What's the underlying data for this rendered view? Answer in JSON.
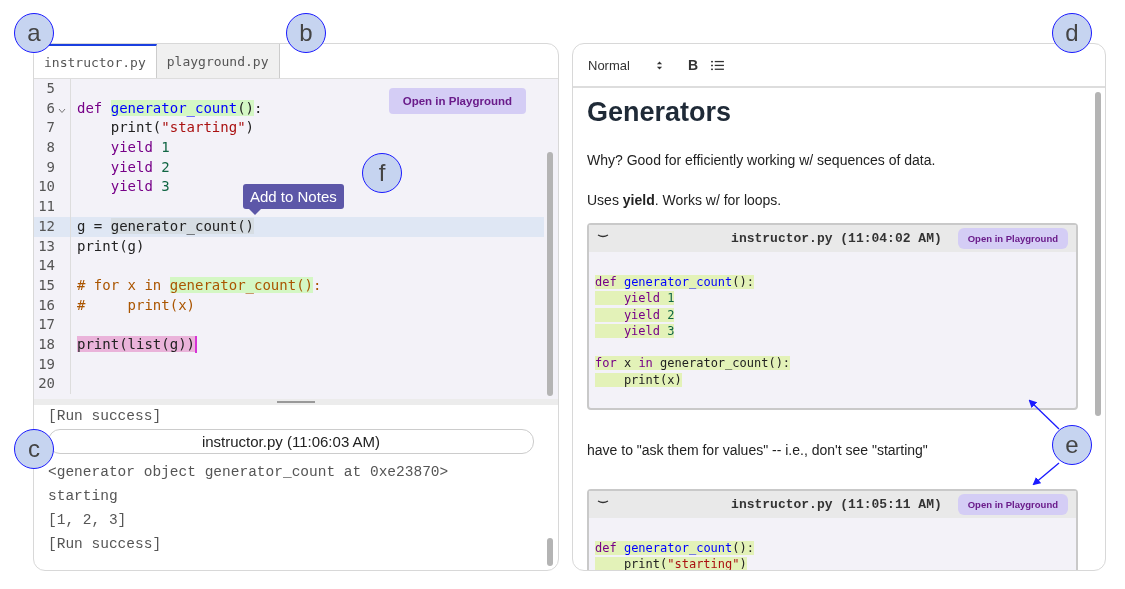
{
  "editor": {
    "tabs": [
      {
        "label": "instructor.py",
        "selected": true
      },
      {
        "label": "playground.py",
        "selected": false
      }
    ],
    "open_button": "Open in Playground",
    "tooltip": "Add to Notes",
    "lines": [
      {
        "number": "5",
        "foldable": false,
        "current": false,
        "cursor": false
      },
      {
        "number": "6",
        "foldable": true,
        "current": false,
        "cursor": false,
        "tokens": [
          {
            "text": "def ",
            "kind": "keyword"
          },
          {
            "text": "generator_count",
            "kind": "function",
            "color": "#d4f7c4"
          },
          {
            "text": "()",
            "kind": "plain",
            "color": "#d4f7c4"
          },
          {
            "text": ":",
            "kind": "plain"
          }
        ]
      },
      {
        "number": "7",
        "foldable": false,
        "current": false,
        "cursor": false,
        "tokens": [
          {
            "text": "    print(",
            "kind": "plain"
          },
          {
            "text": "\"starting\"",
            "kind": "string"
          },
          {
            "text": ")",
            "kind": "plain"
          }
        ]
      },
      {
        "number": "8",
        "foldable": false,
        "current": false,
        "cursor": false,
        "tokens": [
          {
            "text": "    yield ",
            "kind": "keyword"
          },
          {
            "text": "1",
            "kind": "number"
          }
        ]
      },
      {
        "number": "9",
        "foldable": false,
        "current": false,
        "cursor": false,
        "tokens": [
          {
            "text": "    yield ",
            "kind": "keyword"
          },
          {
            "text": "2",
            "kind": "number"
          }
        ]
      },
      {
        "number": "10",
        "foldable": false,
        "current": false,
        "cursor": false,
        "tokens": [
          {
            "text": "    yield ",
            "kind": "keyword"
          },
          {
            "text": "3",
            "kind": "number"
          }
        ]
      },
      {
        "number": "11",
        "foldable": false,
        "current": false,
        "cursor": false
      },
      {
        "number": "12",
        "foldable": false,
        "current": true,
        "cursor": false,
        "tokens": [
          {
            "text": "g = ",
            "kind": "plain"
          },
          {
            "text": "generator_count()",
            "kind": "plain",
            "color": "#d6dde3"
          }
        ]
      },
      {
        "number": "13",
        "foldable": false,
        "current": false,
        "cursor": false,
        "tokens": [
          {
            "text": "print(g)",
            "kind": "plain"
          }
        ]
      },
      {
        "number": "14",
        "foldable": false,
        "current": false,
        "cursor": false
      },
      {
        "number": "15",
        "foldable": false,
        "current": false,
        "cursor": false,
        "tokens": [
          {
            "text": "# for x in ",
            "kind": "comment"
          },
          {
            "text": "generator_count()",
            "kind": "comment",
            "color": "#d4f7c4"
          },
          {
            "text": ":",
            "kind": "comment"
          }
        ]
      },
      {
        "number": "16",
        "foldable": false,
        "current": false,
        "cursor": false,
        "tokens": [
          {
            "text": "#     print(x)",
            "kind": "comment"
          }
        ]
      },
      {
        "number": "17",
        "foldable": false,
        "current": false,
        "cursor": false
      },
      {
        "number": "18",
        "foldable": false,
        "current": false,
        "cursor": true,
        "tokens": [
          {
            "text": "print(list(g))",
            "kind": "plain",
            "color": "#eab3da"
          }
        ]
      },
      {
        "number": "19",
        "foldable": false,
        "current": false,
        "cursor": false
      },
      {
        "number": "20",
        "foldable": false,
        "current": false,
        "cursor": false
      }
    ]
  },
  "console": {
    "previous": "[Run success]",
    "run_header": "instructor.py (11:06:03 AM)",
    "output": [
      "<generator object generator_count at 0xe23870>",
      "starting",
      "[1, 2, 3]",
      "[Run success]"
    ]
  },
  "notes": {
    "toolbar": {
      "style": "Normal",
      "bold": "B"
    },
    "title": "Generators",
    "blocks": [
      {
        "kind": "paragraph",
        "text": "Why? Good for efficiently working w/ sequences of data."
      },
      {
        "kind": "paragraph",
        "text": "Uses **yield**. Works w/ for loops."
      },
      {
        "kind": "snippet",
        "title": "instructor.py (11:04:02 AM)",
        "button": "Open in Playground",
        "lines": [
          {
            "highlighted": true,
            "tokens": [
              {
                "text": "def ",
                "kind": "keyword"
              },
              {
                "text": "generator_count",
                "kind": "function"
              },
              {
                "text": "():",
                "kind": "plain"
              }
            ]
          },
          {
            "highlighted": true,
            "tokens": [
              {
                "text": "    yield ",
                "kind": "keyword"
              },
              {
                "text": "1",
                "kind": "number"
              }
            ]
          },
          {
            "highlighted": true,
            "tokens": [
              {
                "text": "    yield ",
                "kind": "keyword"
              },
              {
                "text": "2",
                "kind": "number"
              }
            ]
          },
          {
            "highlighted": true,
            "tokens": [
              {
                "text": "    yield ",
                "kind": "keyword"
              },
              {
                "text": "3",
                "kind": "number"
              }
            ]
          },
          {
            "highlighted": false
          },
          {
            "highlighted": true,
            "tokens": [
              {
                "text": "for",
                "kind": "keyword"
              },
              {
                "text": " x ",
                "kind": "plain"
              },
              {
                "text": "in",
                "kind": "keyword"
              },
              {
                "text": " generator_count():",
                "kind": "plain"
              }
            ]
          },
          {
            "highlighted": true,
            "tokens": [
              {
                "text": "    print(x)",
                "kind": "plain"
              }
            ]
          }
        ]
      },
      {
        "kind": "paragraph",
        "text": "have to \"ask them for values\" -- i.e., don't see \"starting\""
      },
      {
        "kind": "snippet",
        "title": "instructor.py (11:05:11 AM)",
        "button": "Open in Playground",
        "lines": [
          {
            "highlighted": true,
            "tokens": [
              {
                "text": "def ",
                "kind": "keyword"
              },
              {
                "text": "generator_count",
                "kind": "function"
              },
              {
                "text": "():",
                "kind": "plain"
              }
            ]
          },
          {
            "highlighted": true,
            "tokens": [
              {
                "text": "    print(",
                "kind": "plain"
              },
              {
                "text": "\"starting\"",
                "kind": "string"
              },
              {
                "text": ")",
                "kind": "plain"
              }
            ]
          }
        ]
      }
    ]
  },
  "annotations": [
    {
      "label": "a"
    },
    {
      "label": "b"
    },
    {
      "label": "c"
    },
    {
      "label": "d"
    },
    {
      "label": "e"
    },
    {
      "label": "f"
    }
  ]
}
